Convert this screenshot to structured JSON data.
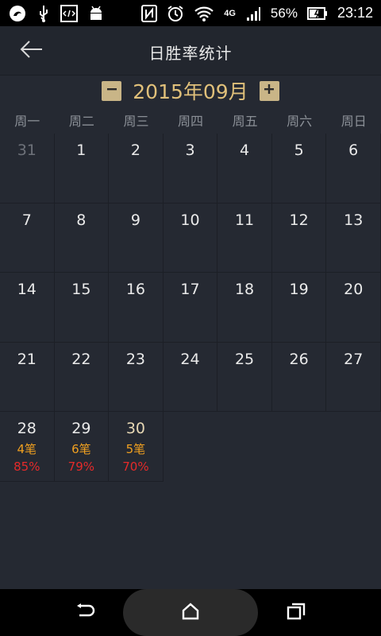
{
  "status_bar": {
    "battery_percent": "56%",
    "time": "23:12",
    "network_label": "4G",
    "left_icons": [
      "app-logo-icon",
      "usb-icon",
      "code-icon",
      "android-icon"
    ],
    "right_icons": [
      "nfc-icon",
      "alarm-icon",
      "wifi-icon",
      "network-4g-icon",
      "signal-icon",
      "battery-icon"
    ]
  },
  "app_bar": {
    "title": "日胜率统计"
  },
  "month_nav": {
    "label": "2015年09月",
    "prev_symbol": "−",
    "next_symbol": "+"
  },
  "weekdays": [
    "周一",
    "周二",
    "周三",
    "周四",
    "周五",
    "周六",
    "周日"
  ],
  "calendar": {
    "days": [
      {
        "day": "31",
        "other_month": true
      },
      {
        "day": "1"
      },
      {
        "day": "2"
      },
      {
        "day": "3"
      },
      {
        "day": "4"
      },
      {
        "day": "5"
      },
      {
        "day": "6"
      },
      {
        "day": "7"
      },
      {
        "day": "8"
      },
      {
        "day": "9"
      },
      {
        "day": "10"
      },
      {
        "day": "11"
      },
      {
        "day": "12"
      },
      {
        "day": "13"
      },
      {
        "day": "14"
      },
      {
        "day": "15"
      },
      {
        "day": "16"
      },
      {
        "day": "17"
      },
      {
        "day": "18"
      },
      {
        "day": "19"
      },
      {
        "day": "20"
      },
      {
        "day": "21"
      },
      {
        "day": "22"
      },
      {
        "day": "23"
      },
      {
        "day": "24"
      },
      {
        "day": "25"
      },
      {
        "day": "26"
      },
      {
        "day": "27"
      },
      {
        "day": "28",
        "count": "4笔",
        "rate": "85%"
      },
      {
        "day": "29",
        "count": "6笔",
        "rate": "79%"
      },
      {
        "day": "30",
        "count": "5笔",
        "rate": "70%",
        "highlight": true
      }
    ]
  },
  "colors": {
    "background": "#252932",
    "accent_gold": "#e0c07a",
    "count_orange": "#f0a020",
    "rate_red": "#e52a2a"
  },
  "nav_bar": {
    "icons": [
      "back-icon",
      "home-icon",
      "recents-icon"
    ]
  }
}
